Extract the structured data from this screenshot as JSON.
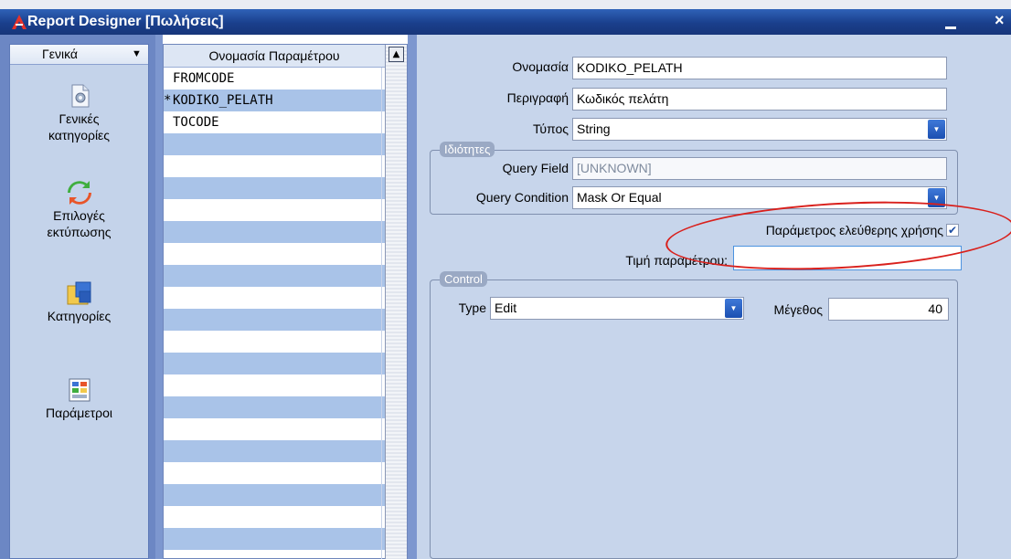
{
  "window": {
    "title": "Report Designer [Πωλήσεις]",
    "minimize_label": "",
    "close_label": "×"
  },
  "left_panel": {
    "header_label": "Γενικά",
    "header_arrow": "▼",
    "items": [
      {
        "label_line1": "Γενικές",
        "label_line2": "κατηγορίες",
        "icon": "general-categories-icon"
      },
      {
        "label_line1": "Επιλογές",
        "label_line2": "εκτύπωσης",
        "icon": "print-options-icon"
      },
      {
        "label_line1": "Κατηγορίες",
        "label_line2": "",
        "icon": "categories-icon"
      },
      {
        "label_line1": "Παράμετροι",
        "label_line2": "",
        "icon": "parameters-icon"
      }
    ]
  },
  "parameter_grid": {
    "column_header": "Ονομασία Παραμέτρου",
    "rows": [
      {
        "marker": "",
        "name": "FROMCODE"
      },
      {
        "marker": "*",
        "name": "KODIKO_PELATH"
      },
      {
        "marker": "",
        "name": "TOCODE"
      }
    ],
    "scroll_up_label": "▲"
  },
  "details": {
    "name_label": "Ονομασία",
    "name_value": "KODIKO_PELATH",
    "description_label": "Περιγραφή",
    "description_value": "Κωδικός πελάτη",
    "type_label": "Τύπος",
    "type_value": "String",
    "properties_group": "Ιδιότητες",
    "query_field_label": "Query Field",
    "query_field_value": "[UNKNOWN]",
    "query_condition_label": "Query Condition",
    "query_condition_value": "Mask Or Equal",
    "free_use_label": "Παράμετρος ελεύθερης χρήσης",
    "free_use_checked": true,
    "parameter_value_label": "Τιμή παραμέτρου:",
    "parameter_value": "",
    "control_group": "Control",
    "control_type_label": "Type",
    "control_type_value": "Edit",
    "size_label": "Μέγεθος",
    "size_value": "40"
  },
  "colors": {
    "title_bar": "#1a3f8c",
    "highlight_row": "#a9c3e8",
    "annotation": "#d9201c"
  }
}
